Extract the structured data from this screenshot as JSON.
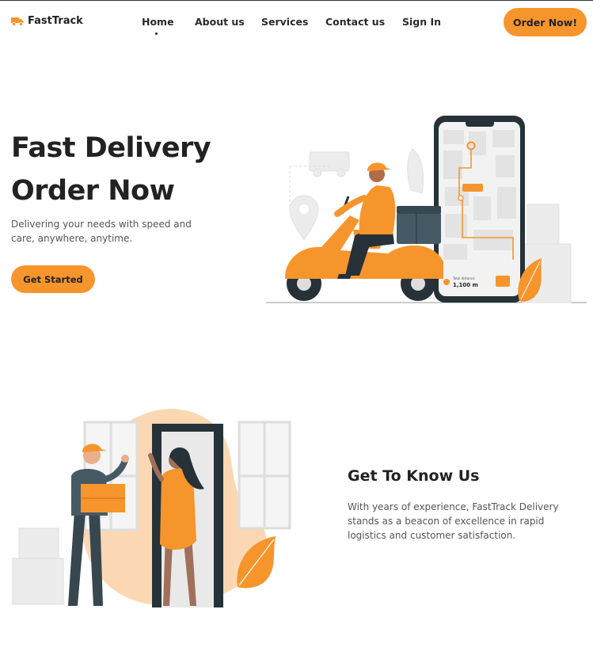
{
  "brand": {
    "name": "FastTrack",
    "icon": "truck-icon",
    "accent": "#f7952d"
  },
  "nav": {
    "items": [
      {
        "label": "Home",
        "active": true
      },
      {
        "label": "About us"
      },
      {
        "label": "Services"
      },
      {
        "label": "Contact us"
      },
      {
        "label": "Sign In"
      }
    ],
    "cta": "Order Now!"
  },
  "hero": {
    "title_line1": "Fast Delivery",
    "title_line2": "Order Now",
    "subtitle": "Delivering your needs with speed and care, anywhere, anytime.",
    "button": "Get Started",
    "phone_distance": "1,100 m",
    "phone_distance_label": "Total distance"
  },
  "about": {
    "title": "Get To Know Us",
    "text": "With years of experience, FastTrack Delivery stands as a beacon of excellence in rapid logistics and customer satisfaction."
  }
}
